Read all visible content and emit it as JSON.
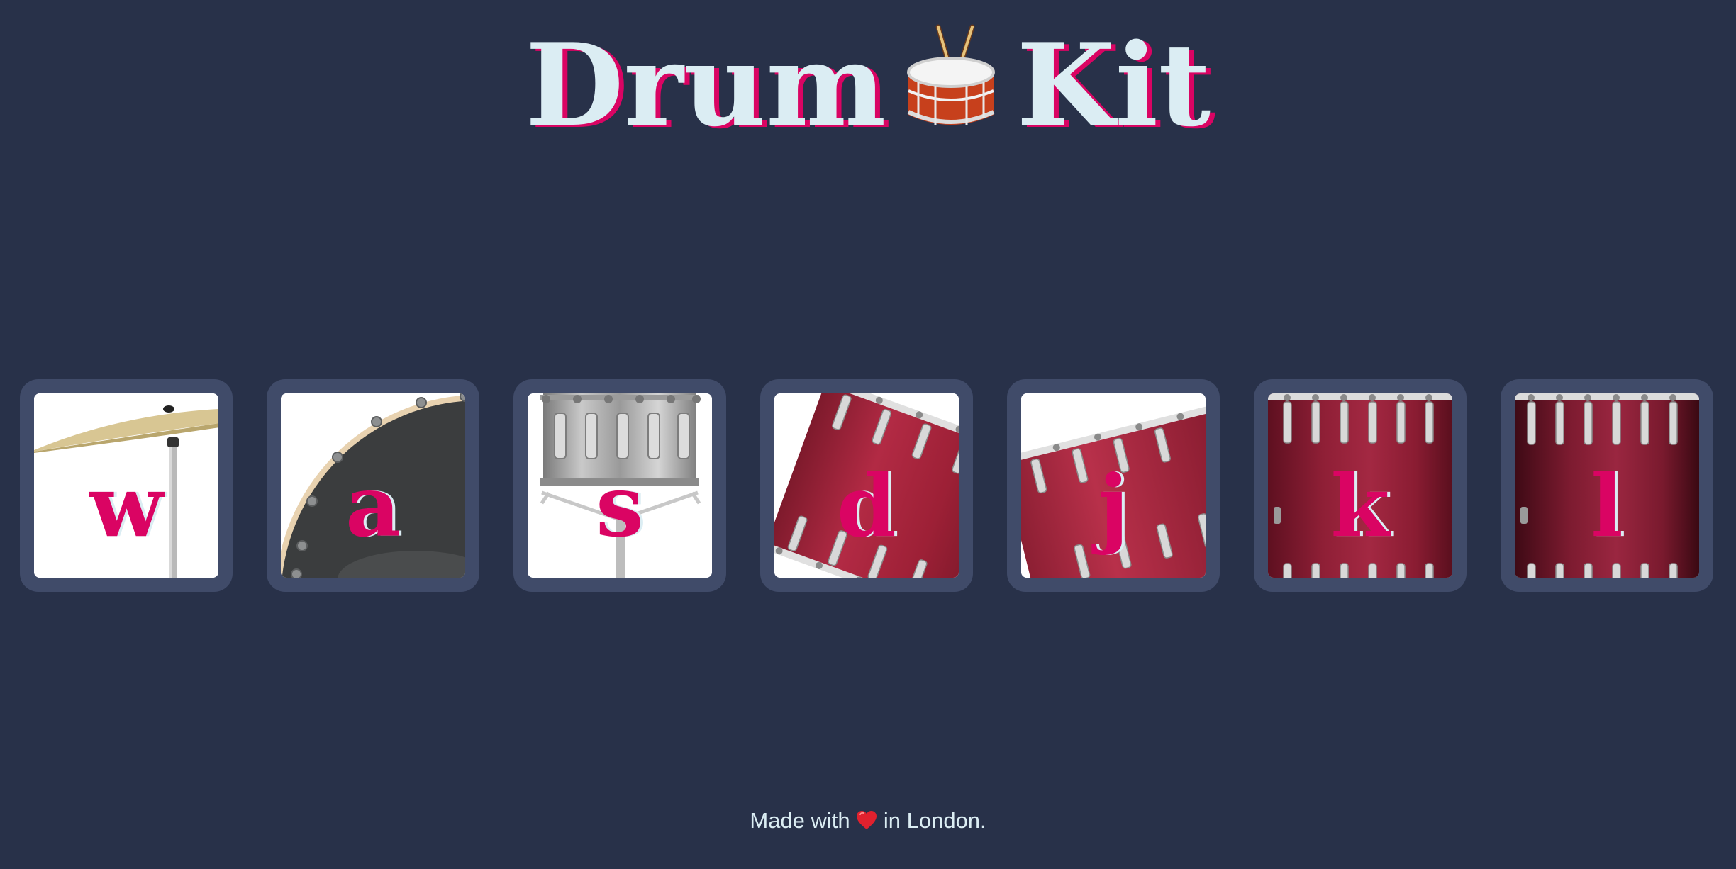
{
  "header": {
    "title_left": "Drum",
    "title_icon": "drum-with-drumsticks-icon",
    "title_right": "Kit"
  },
  "drums": [
    {
      "key": "w",
      "instrument_icon": "crash-cymbal-icon"
    },
    {
      "key": "a",
      "instrument_icon": "kick-drum-icon"
    },
    {
      "key": "s",
      "instrument_icon": "snare-drum-icon"
    },
    {
      "key": "d",
      "instrument_icon": "tom-1-icon"
    },
    {
      "key": "j",
      "instrument_icon": "tom-2-icon"
    },
    {
      "key": "k",
      "instrument_icon": "tom-3-icon"
    },
    {
      "key": "l",
      "instrument_icon": "tom-4-icon"
    }
  ],
  "footer": {
    "prefix": "Made with",
    "icon": "heart-icon",
    "suffix": "in London."
  },
  "colors": {
    "background": "#283149",
    "button_frame": "#404b69",
    "accent": "#da0463",
    "light": "#dbedf3"
  }
}
